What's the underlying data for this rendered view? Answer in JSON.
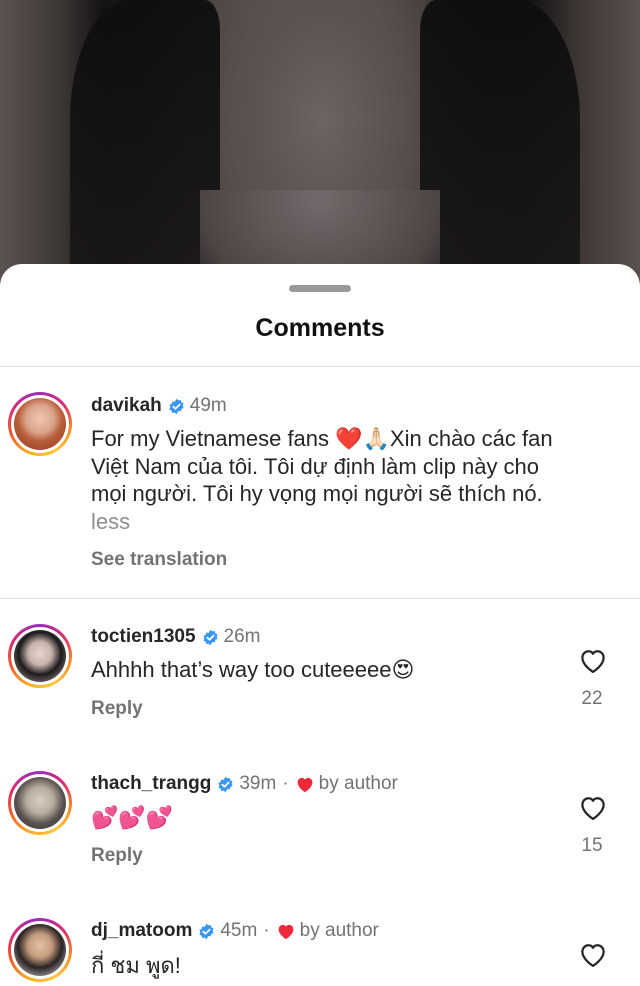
{
  "sheet": {
    "title": "Comments"
  },
  "comments": [
    {
      "username": "davikah",
      "time": "49m",
      "text_line1": "For my Vietnamese fans ❤️🙏🏻Xin chào các fan",
      "text_line2": "Việt Nam của tôi. Tôi dự định làm clip này cho",
      "text_line3": "mọi người. Tôi hy vọng mọi người sẽ thích nó.",
      "less_label": "less",
      "see_translation": "See translation"
    },
    {
      "username": "toctien1305",
      "time": "26m",
      "text": "Ahhhh that’s way too cuteeeee😍",
      "reply_label": "Reply",
      "like_count": "22"
    },
    {
      "username": "thach_trangg",
      "time": "39m",
      "separator": "·",
      "by_author": "by author",
      "text": "💕💕💕",
      "reply_label": "Reply",
      "like_count": "15"
    },
    {
      "username": "dj_matoom",
      "time": "45m",
      "separator": "·",
      "by_author": "by author",
      "text": "กี่ ชม พูด!"
    }
  ],
  "icons": {
    "verified": "verified-badge-icon",
    "heart": "heart-outline-icon",
    "author_heart": "red-heart-icon"
  },
  "colors": {
    "verified_blue": "#3897f0",
    "author_heart_red": "#ed2a3a",
    "secondary_text": "#737373"
  }
}
